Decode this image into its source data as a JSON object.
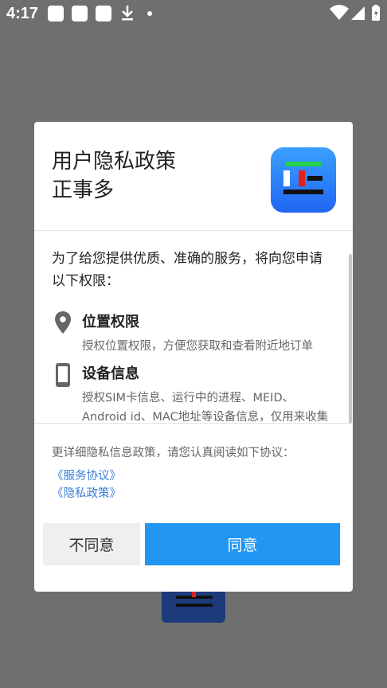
{
  "status_bar": {
    "time": "4:17"
  },
  "dialog": {
    "title_line1": "用户隐私政策",
    "title_line2": "正事多",
    "intro": "为了给您提供优质、准确的服务，将向您申请以下权限：",
    "permissions": [
      {
        "icon": "location-pin-icon",
        "title": "位置权限",
        "desc": "授权位置权限，方便您获取和查看附近地订单"
      },
      {
        "icon": "phone-device-icon",
        "title": "设备信息",
        "desc_line1": "授权SIM卡信息、运行中的进程、MEID、",
        "desc_line2": "Android id、MAC地址等设备信息，仅用来收集"
      }
    ],
    "footer_text": "更详细隐私信息政策，请您认真阅读如下协议：",
    "links": [
      "《服务协议》",
      "《隐私政策》"
    ],
    "buttons": {
      "disagree": "不同意",
      "agree": "同意"
    }
  },
  "colors": {
    "accent": "#2196f3",
    "link": "#3d7fd9",
    "scrim": "#6f6f6f"
  }
}
